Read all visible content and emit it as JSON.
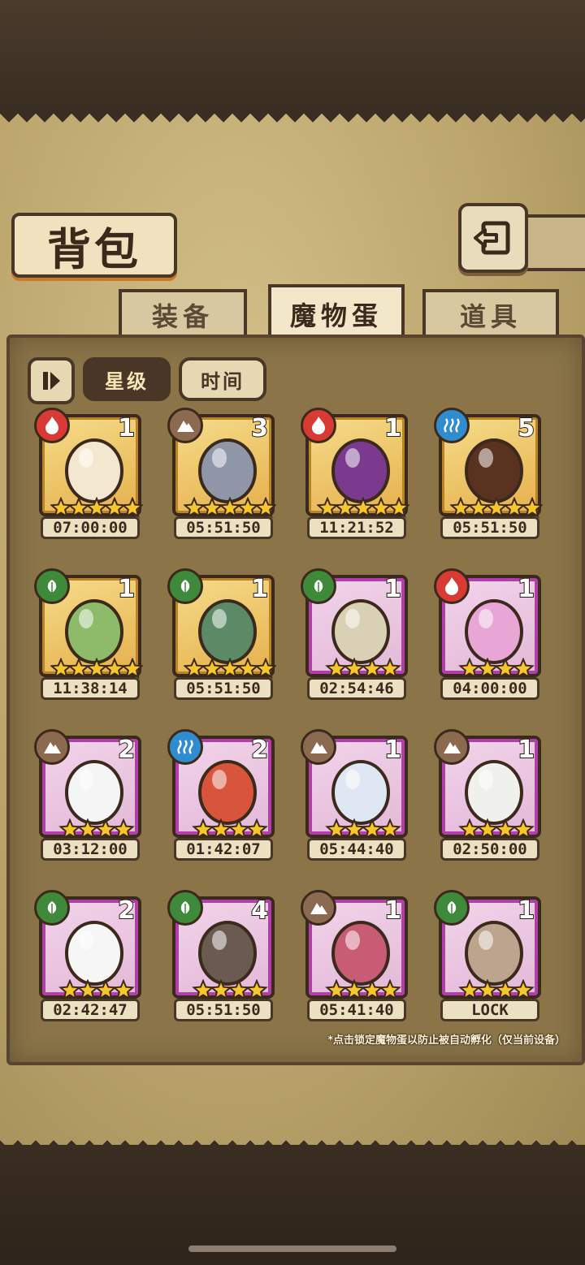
{
  "title": "背包",
  "tabs": [
    {
      "label": "装备",
      "active": false
    },
    {
      "label": "魔物蛋",
      "active": true
    },
    {
      "label": "道具",
      "active": false
    }
  ],
  "sort": {
    "star": "星级",
    "time": "时间",
    "selected": "星级"
  },
  "eggs": [
    {
      "element": "fire",
      "count": "1",
      "stars": 5,
      "rarity": "gold",
      "timer": "07:00:00"
    },
    {
      "element": "earth",
      "count": "3",
      "stars": 5,
      "rarity": "gold",
      "timer": "05:51:50"
    },
    {
      "element": "fire",
      "count": "1",
      "stars": 5,
      "rarity": "gold",
      "timer": "11:21:52"
    },
    {
      "element": "water",
      "count": "5",
      "stars": 5,
      "rarity": "gold",
      "timer": "05:51:50"
    },
    {
      "element": "leaf",
      "count": "1",
      "stars": 5,
      "rarity": "gold",
      "timer": "11:38:14"
    },
    {
      "element": "leaf",
      "count": "1",
      "stars": 5,
      "rarity": "gold",
      "timer": "05:51:50"
    },
    {
      "element": "leaf",
      "count": "1",
      "stars": 4,
      "rarity": "purple",
      "timer": "02:54:46"
    },
    {
      "element": "fire",
      "count": "1",
      "stars": 4,
      "rarity": "purple",
      "timer": "04:00:00"
    },
    {
      "element": "earth",
      "count": "2",
      "stars": 4,
      "rarity": "purple",
      "timer": "03:12:00"
    },
    {
      "element": "water",
      "count": "2",
      "stars": 4,
      "rarity": "purple",
      "timer": "01:42:07"
    },
    {
      "element": "earth",
      "count": "1",
      "stars": 4,
      "rarity": "purple",
      "timer": "05:44:40"
    },
    {
      "element": "earth",
      "count": "1",
      "stars": 4,
      "rarity": "purple",
      "timer": "02:50:00"
    },
    {
      "element": "leaf",
      "count": "2",
      "stars": 4,
      "rarity": "purple",
      "timer": "02:42:47"
    },
    {
      "element": "leaf",
      "count": "4",
      "stars": 4,
      "rarity": "purple",
      "timer": "05:51:50"
    },
    {
      "element": "earth",
      "count": "1",
      "stars": 4,
      "rarity": "purple",
      "timer": "05:41:40"
    },
    {
      "element": "leaf",
      "count": "1",
      "stars": 4,
      "rarity": "purple",
      "timer": "LOCK"
    }
  ],
  "hint": "*点击锁定魔物蛋以防止被自动孵化（仅当前设备）",
  "colors": {
    "fire": "#d83a34",
    "earth": "#8c6a50",
    "water": "#2e8ccf",
    "leaf": "#3f8a3a",
    "star": "#f7c52c"
  }
}
